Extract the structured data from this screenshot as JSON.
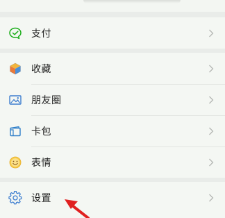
{
  "menu": {
    "pay": {
      "label": "支付",
      "icon": "pay-icon"
    },
    "favorites": {
      "label": "收藏",
      "icon": "cube-icon"
    },
    "moments": {
      "label": "朋友圈",
      "icon": "image-icon"
    },
    "cards": {
      "label": "卡包",
      "icon": "card-wallet-icon"
    },
    "stickers": {
      "label": "表情",
      "icon": "smiley-icon"
    },
    "settings": {
      "label": "设置",
      "icon": "gear-icon"
    }
  },
  "colors": {
    "background": "#e9ece9",
    "row_background": "#f4f7f3",
    "pay_green": "#1aad19",
    "annotation_red": "#e02020"
  }
}
